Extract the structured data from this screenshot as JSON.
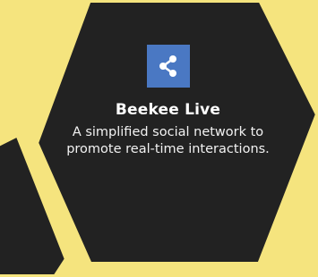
{
  "colors": {
    "background": "#f5e47e",
    "hexagon": "#222222",
    "accent_tile": "#4a78c3",
    "text": "#ffffff"
  },
  "card": {
    "icon": "share-icon",
    "title": "Beekee Live",
    "description": "A simplified social network to promote real-time interactions."
  }
}
